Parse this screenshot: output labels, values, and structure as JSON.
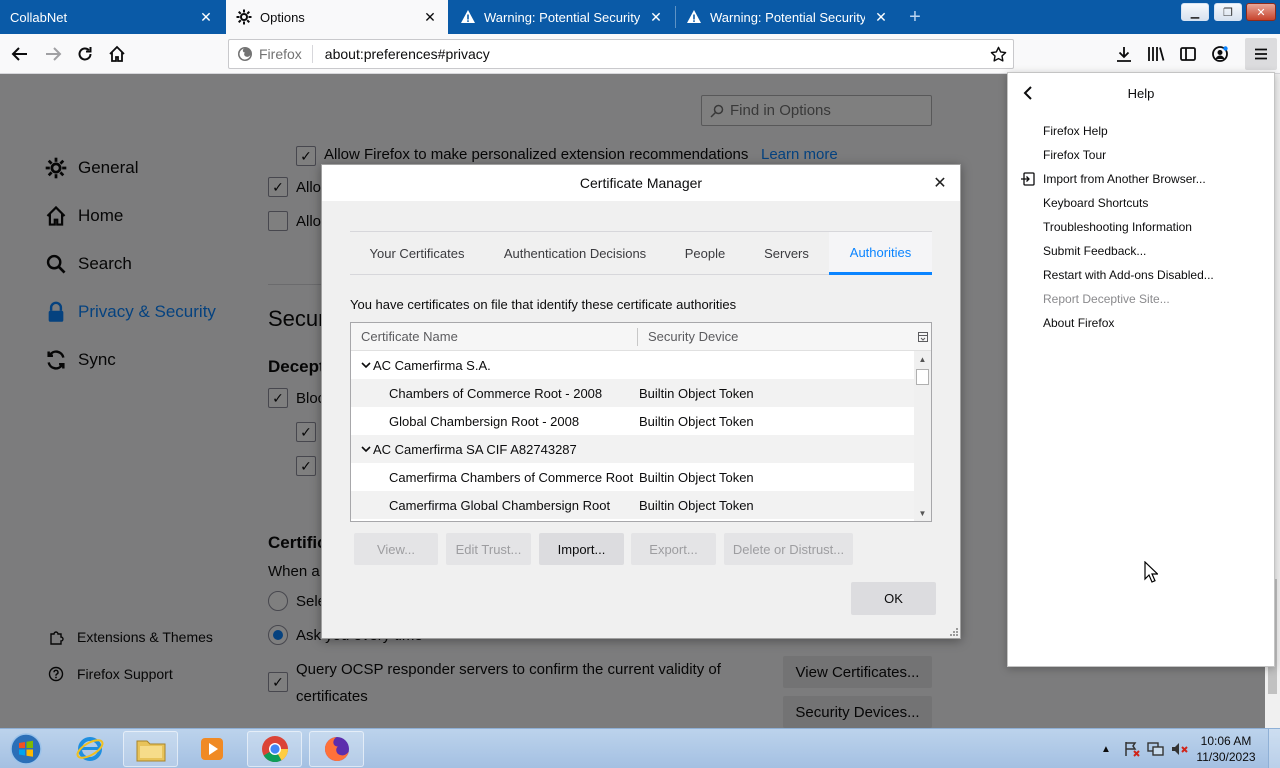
{
  "browser": {
    "tabs": [
      {
        "title": "CollabNet",
        "icon": "none",
        "active": false
      },
      {
        "title": "Options",
        "icon": "gear-icon",
        "active": true
      },
      {
        "title": "Warning: Potential Security Risk",
        "icon": "warning-icon",
        "active": false
      },
      {
        "title": "Warning: Potential Security Risk",
        "icon": "warning-icon",
        "active": false
      }
    ],
    "url_identity": "Firefox",
    "url": "about:preferences#privacy"
  },
  "prefs": {
    "find_placeholder": "Find in Options",
    "categories": [
      {
        "label": "General",
        "icon": "gear-icon"
      },
      {
        "label": "Home",
        "icon": "home-icon"
      },
      {
        "label": "Search",
        "icon": "search-icon"
      },
      {
        "label": "Privacy & Security",
        "icon": "lock-icon",
        "selected": true
      },
      {
        "label": "Sync",
        "icon": "sync-icon"
      }
    ],
    "footer_links": [
      {
        "label": "Extensions & Themes",
        "icon": "puzzle-icon"
      },
      {
        "label": "Firefox Support",
        "icon": "help-icon"
      }
    ],
    "partial": {
      "allow_recommend": "Allow Firefox to make personalized extension recommendations",
      "learn_more": "Learn more",
      "allo1": "Allo",
      "allo2": "Allo",
      "secur": "Securi",
      "decep": "Decept",
      "bloc": "Bloc",
      "certif": "Certific",
      "when_a": "When a",
      "sele": "Sele",
      "ask_every": "Ask you every time",
      "ocsp_line1": "Query OCSP responder servers to confirm the current validity of",
      "ocsp_line2": "certificates",
      "view_certs": "View Certificates...",
      "security_devices": "Security Devices..."
    }
  },
  "dialog": {
    "title": "Certificate Manager",
    "tabs": [
      {
        "label": "Your Certificates",
        "selected": false
      },
      {
        "label": "Authentication Decisions",
        "selected": false
      },
      {
        "label": "People",
        "selected": false
      },
      {
        "label": "Servers",
        "selected": false
      },
      {
        "label": "Authorities",
        "selected": true
      }
    ],
    "description": "You have certificates on file that identify these certificate authorities",
    "columns": [
      "Certificate Name",
      "Security Device"
    ],
    "rows": [
      {
        "type": "group",
        "name": "AC Camerfirma S.A."
      },
      {
        "type": "cert",
        "name": "Chambers of Commerce Root - 2008",
        "device": "Builtin Object Token"
      },
      {
        "type": "cert",
        "name": "Global Chambersign Root - 2008",
        "device": "Builtin Object Token"
      },
      {
        "type": "group",
        "name": "AC Camerfirma SA CIF A82743287"
      },
      {
        "type": "cert",
        "name": "Camerfirma Chambers of Commerce Root",
        "device": "Builtin Object Token"
      },
      {
        "type": "cert",
        "name": "Camerfirma Global Chambersign Root",
        "device": "Builtin Object Token"
      }
    ],
    "buttons": {
      "view": "View...",
      "edit_trust": "Edit Trust...",
      "import": "Import...",
      "export": "Export...",
      "delete": "Delete or Distrust...",
      "ok": "OK"
    }
  },
  "help_panel": {
    "title": "Help",
    "items": [
      {
        "label": "Firefox Help",
        "disabled": false
      },
      {
        "label": "Firefox Tour",
        "disabled": false
      },
      {
        "label": "Import from Another Browser...",
        "disabled": false
      },
      {
        "label": "Keyboard Shortcuts",
        "disabled": false
      },
      {
        "label": "Troubleshooting Information",
        "disabled": false
      },
      {
        "label": "Submit Feedback...",
        "disabled": false
      },
      {
        "label": "Restart with Add-ons Disabled...",
        "disabled": false
      },
      {
        "label": "Report Deceptive Site...",
        "disabled": true
      },
      {
        "label": "About Firefox",
        "disabled": false
      }
    ]
  },
  "taskbar": {
    "apps": [
      "start-orb",
      "internet-explorer",
      "file-explorer",
      "media-player",
      "chrome",
      "firefox"
    ],
    "time": "10:06 AM",
    "date": "11/30/2023"
  },
  "colors": {
    "tabstrip": "#0a5aa7",
    "accent": "#0a84ff",
    "taskbar": "#a4c0e2"
  }
}
